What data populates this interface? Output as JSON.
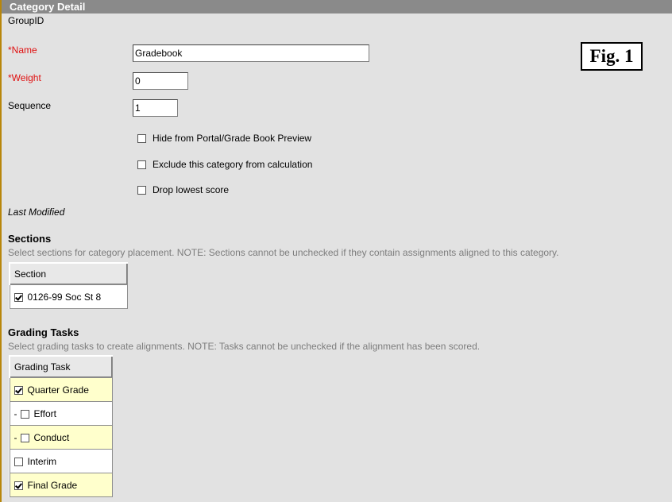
{
  "header": {
    "title": "Category Detail"
  },
  "fig_label": "Fig. 1",
  "form": {
    "group_id_label": "GroupID",
    "name_label": "*Name",
    "name_value": "Gradebook",
    "weight_label": "*Weight",
    "weight_value": "0",
    "sequence_label": "Sequence",
    "sequence_value": "1",
    "options": [
      {
        "label": "Hide from Portal/Grade Book Preview",
        "checked": false
      },
      {
        "label": "Exclude this category from calculation",
        "checked": false
      },
      {
        "label": "Drop lowest score",
        "checked": false
      }
    ],
    "last_modified_label": "Last Modified"
  },
  "sections": {
    "title": "Sections",
    "hint": "Select sections for category placement. NOTE: Sections cannot be unchecked if they contain assignments aligned to this category.",
    "column_header": "Section",
    "rows": [
      {
        "label": "0126-99 Soc St 8",
        "checked": true
      }
    ]
  },
  "grading_tasks": {
    "title": "Grading Tasks",
    "hint": "Select grading tasks to create alignments. NOTE: Tasks cannot be unchecked if the alignment has been scored.",
    "column_header": "Grading Task",
    "rows": [
      {
        "label": "Quarter Grade",
        "checked": true,
        "prefix": "",
        "highlight": true
      },
      {
        "label": "Effort",
        "checked": false,
        "prefix": "-",
        "highlight": false
      },
      {
        "label": "Conduct",
        "checked": false,
        "prefix": "-",
        "highlight": true
      },
      {
        "label": "Interim",
        "checked": false,
        "prefix": "",
        "highlight": false
      },
      {
        "label": "Final Grade",
        "checked": true,
        "prefix": "",
        "highlight": true
      }
    ]
  }
}
